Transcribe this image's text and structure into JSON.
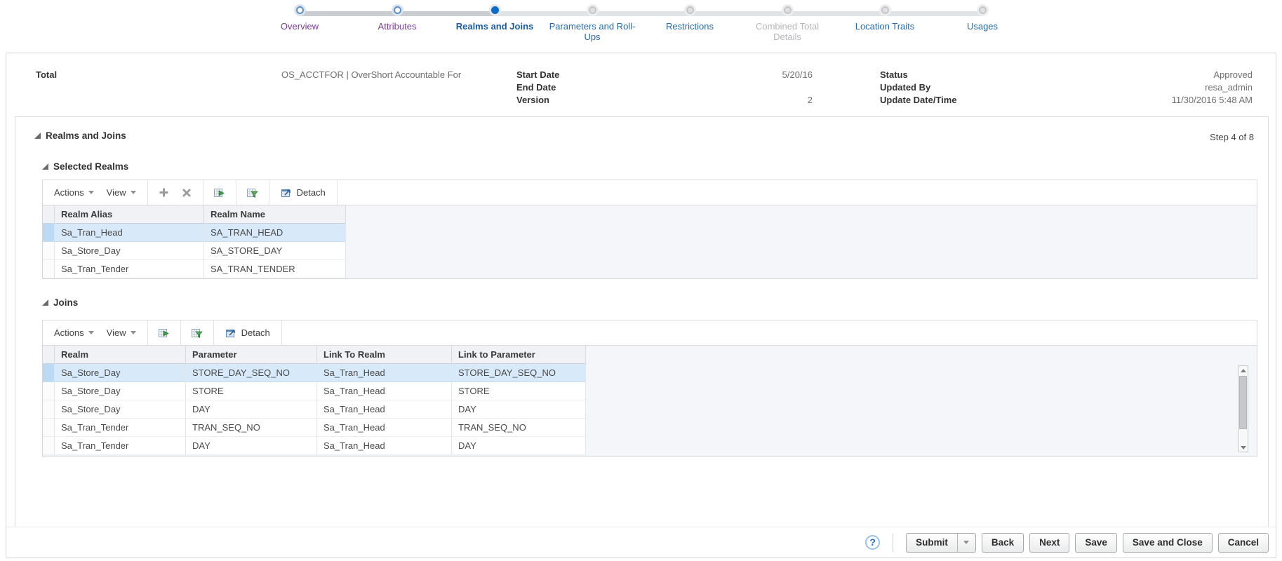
{
  "train": {
    "steps": [
      {
        "label": "Overview",
        "state": "visited"
      },
      {
        "label": "Attributes",
        "state": "visited"
      },
      {
        "label": "Realms and Joins",
        "state": "current"
      },
      {
        "label": "Parameters and Roll-Ups",
        "state": "enabled"
      },
      {
        "label": "Restrictions",
        "state": "enabled"
      },
      {
        "label": "Combined Total Details",
        "state": "disabled"
      },
      {
        "label": "Location Traits",
        "state": "enabled"
      },
      {
        "label": "Usages",
        "state": "enabled"
      }
    ]
  },
  "header": {
    "total_label": "Total",
    "total_value": "OS_ACCTFOR | OverShort Accountable For",
    "start_date_label": "Start Date",
    "start_date_value": "5/20/16",
    "end_date_label": "End Date",
    "end_date_value": "",
    "version_label": "Version",
    "version_value": "2",
    "status_label": "Status",
    "status_value": "Approved",
    "updated_by_label": "Updated By",
    "updated_by_value": "resa_admin",
    "update_datetime_label": "Update Date/Time",
    "update_datetime_value": "11/30/2016 5:48 AM"
  },
  "section": {
    "title": "Realms and Joins",
    "step_indicator": "Step 4 of 8"
  },
  "selected_realms": {
    "title": "Selected Realms",
    "toolbar": {
      "actions_label": "Actions",
      "view_label": "View",
      "detach_label": "Detach"
    },
    "columns": [
      "Realm Alias",
      "Realm Name"
    ],
    "rows": [
      [
        "Sa_Tran_Head",
        "SA_TRAN_HEAD"
      ],
      [
        "Sa_Store_Day",
        "SA_STORE_DAY"
      ],
      [
        "Sa_Tran_Tender",
        "SA_TRAN_TENDER"
      ]
    ],
    "selected_row_index": 0
  },
  "joins": {
    "title": "Joins",
    "toolbar": {
      "actions_label": "Actions",
      "view_label": "View",
      "detach_label": "Detach"
    },
    "columns": [
      "Realm",
      "Parameter",
      "Link To Realm",
      "Link to Parameter"
    ],
    "rows": [
      [
        "Sa_Store_Day",
        "STORE_DAY_SEQ_NO",
        "Sa_Tran_Head",
        "STORE_DAY_SEQ_NO"
      ],
      [
        "Sa_Store_Day",
        "STORE",
        "Sa_Tran_Head",
        "STORE"
      ],
      [
        "Sa_Store_Day",
        "DAY",
        "Sa_Tran_Head",
        "DAY"
      ],
      [
        "Sa_Tran_Tender",
        "TRAN_SEQ_NO",
        "Sa_Tran_Head",
        "TRAN_SEQ_NO"
      ],
      [
        "Sa_Tran_Tender",
        "DAY",
        "Sa_Tran_Head",
        "DAY"
      ]
    ],
    "selected_row_index": 0
  },
  "footer": {
    "help_label": "?",
    "submit_label": "Submit",
    "back_label": "Back",
    "next_label": "Next",
    "save_label": "Save",
    "save_and_close_label": "Save and Close",
    "cancel_label": "Cancel"
  },
  "icons": {
    "add": "plus",
    "delete": "x-cross",
    "export_to_excel": "grid-with-green-arrow",
    "query_by_example": "grid-with-green-funnel",
    "detach": "window-with-ne-arrow",
    "help": "question-mark-circle",
    "menu_caret": "chevron-down",
    "disclosure": "expanded-triangle"
  },
  "colors": {
    "accent_blue": "#0c6cc8",
    "current_step_text": "#1a5b9e",
    "visited_step_text": "#7b3d94",
    "link_blue": "#2569a8",
    "disabled_gray": "#b4b6b8",
    "selected_row_bg": "#d8eafa",
    "table_header_bg": "#f0f2f5",
    "table_empty_bg": "#f4f6f9",
    "panel_border": "#d8d8d8"
  }
}
